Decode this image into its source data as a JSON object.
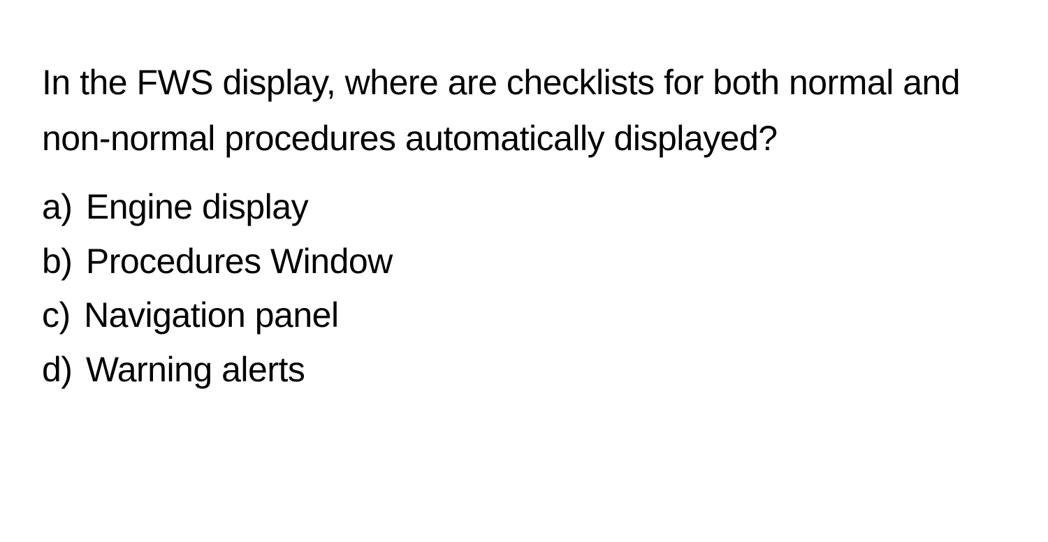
{
  "question": "In the FWS display, where are checklists for both normal and non-normal procedures automatically displayed?",
  "options": [
    {
      "label": "a)",
      "text": "Engine display"
    },
    {
      "label": "b)",
      "text": "Procedures Window"
    },
    {
      "label": "c)",
      "text": "Navigation panel"
    },
    {
      "label": "d)",
      "text": "Warning alerts"
    }
  ]
}
